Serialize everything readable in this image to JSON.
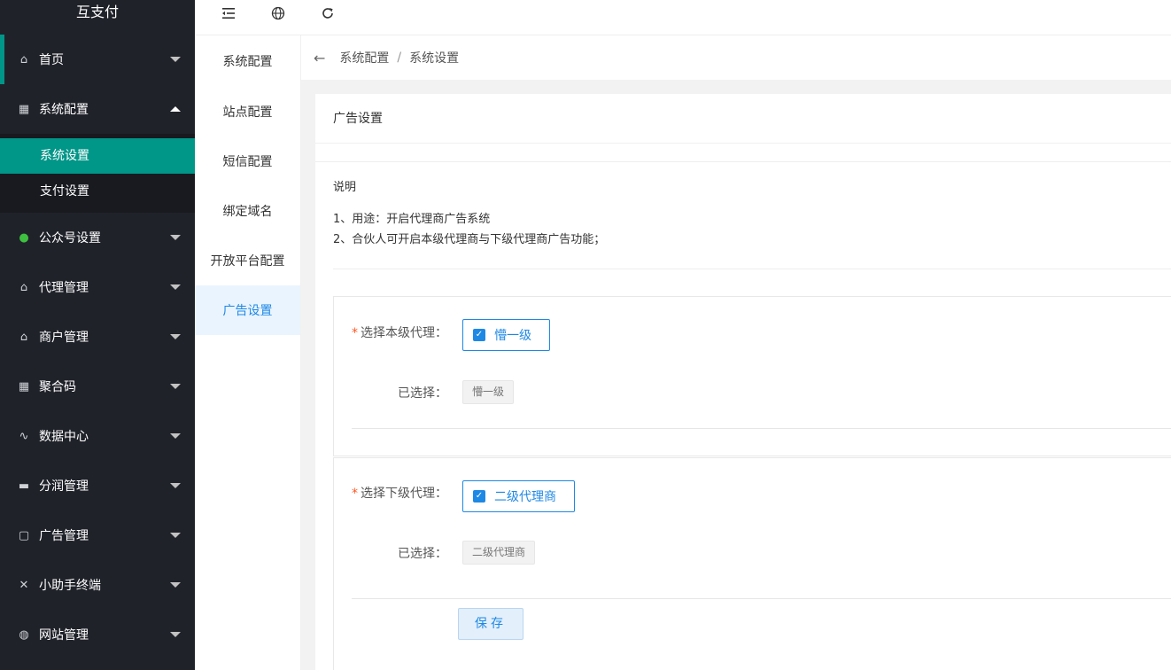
{
  "app": {
    "title": "互支付"
  },
  "sidebar": {
    "items": [
      {
        "label": "首页",
        "icon": "home-icon"
      },
      {
        "label": "系统配置",
        "icon": "settings-icon",
        "expanded": true,
        "children": [
          {
            "label": "系统设置",
            "selected": true
          },
          {
            "label": "支付设置"
          }
        ]
      },
      {
        "label": "公众号设置",
        "icon": "wechat-icon"
      },
      {
        "label": "代理管理",
        "icon": "home-icon"
      },
      {
        "label": "商户管理",
        "icon": "home-icon"
      },
      {
        "label": "聚合码",
        "icon": "settings-icon"
      },
      {
        "label": "数据中心",
        "icon": "chart-line-icon"
      },
      {
        "label": "分润管理",
        "icon": "monitor-icon"
      },
      {
        "label": "广告管理",
        "icon": "clipboard-icon"
      },
      {
        "label": "小助手终端",
        "icon": "tools-icon"
      },
      {
        "label": "网站管理",
        "icon": "globe-icon"
      }
    ]
  },
  "topbar": {
    "icons": [
      "menu-collapse-icon",
      "globe-icon",
      "refresh-icon"
    ]
  },
  "subnav": {
    "items": [
      "系统配置",
      "站点配置",
      "短信配置",
      "绑定域名",
      "开放平台配置",
      "广告设置"
    ],
    "active_index": 5
  },
  "breadcrumb": {
    "items": [
      "系统配置",
      "系统设置"
    ],
    "separator": "/"
  },
  "card": {
    "title": "广告设置",
    "note": {
      "title": "说明",
      "lines": [
        "1、用途：开启代理商广告系统",
        "2、合伙人可开启本级代理商与下级代理商广告功能；"
      ]
    },
    "section1": {
      "required_mark": "*",
      "label": "选择本级代理：",
      "option": "懵一级",
      "checked": true,
      "selected_label": "已选择：",
      "selected_value": "懵一级"
    },
    "section2": {
      "required_mark": "*",
      "label": "选择下级代理：",
      "option": "二级代理商",
      "checked": true,
      "selected_label": "已选择：",
      "selected_value": "二级代理商"
    },
    "save_label": "保存"
  },
  "colors": {
    "sidebar_bg": "#20222a",
    "accent": "#009688",
    "primary": "#1e88e5",
    "required": "#ff5722"
  }
}
